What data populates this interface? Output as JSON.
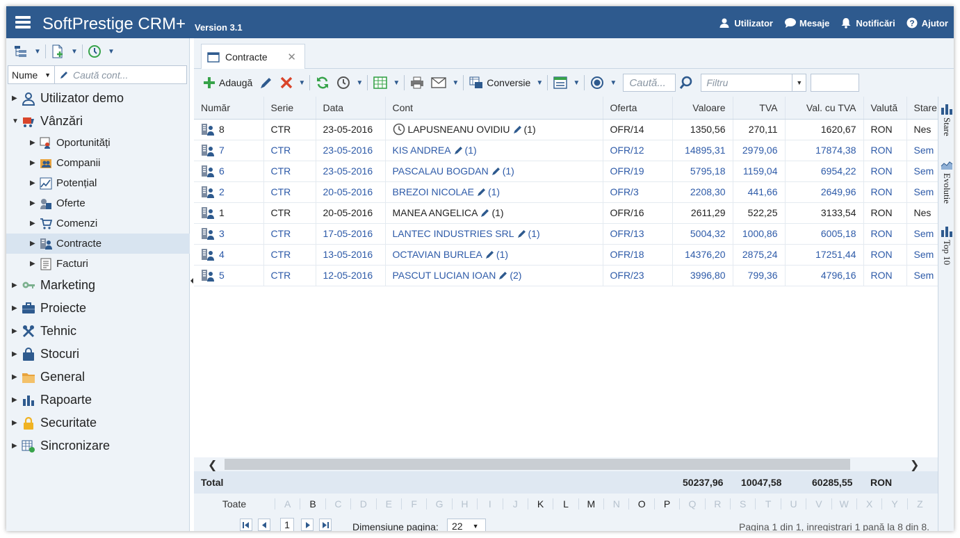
{
  "header": {
    "app_title": "SoftPrestige CRM+",
    "version": "Version 3.1",
    "links": [
      {
        "label": "Utilizator",
        "icon": "user-icon"
      },
      {
        "label": "Mesaje",
        "icon": "chat-icon"
      },
      {
        "label": "Notificări",
        "icon": "bell-icon"
      },
      {
        "label": "Ajutor",
        "icon": "help-icon"
      }
    ],
    "color": "#2e5a8e"
  },
  "sidebar": {
    "search": {
      "field": "Nume",
      "placeholder": "Caută cont..."
    },
    "tree": [
      {
        "label": "Utilizator demo",
        "icon": "user-outline-icon",
        "level": 1
      },
      {
        "label": "Vânzări",
        "icon": "cart-icon",
        "level": 1,
        "expanded": true
      },
      {
        "label": "Oportunități",
        "icon": "opportunity-icon",
        "level": 2
      },
      {
        "label": "Companii",
        "icon": "companies-icon",
        "level": 2
      },
      {
        "label": "Potențial",
        "icon": "chart-line-icon",
        "level": 2
      },
      {
        "label": "Oferte",
        "icon": "offers-icon",
        "level": 2
      },
      {
        "label": "Comenzi",
        "icon": "basket-icon",
        "level": 2
      },
      {
        "label": "Contracte",
        "icon": "contract-icon",
        "level": 2,
        "selected": true
      },
      {
        "label": "Facturi",
        "icon": "invoice-icon",
        "level": 2
      },
      {
        "label": "Marketing",
        "icon": "key-icon",
        "level": 1
      },
      {
        "label": "Proiecte",
        "icon": "briefcase-icon",
        "level": 1
      },
      {
        "label": "Tehnic",
        "icon": "tools-icon",
        "level": 1
      },
      {
        "label": "Stocuri",
        "icon": "bag-icon",
        "level": 1
      },
      {
        "label": "General",
        "icon": "folder-icon",
        "level": 1
      },
      {
        "label": "Rapoarte",
        "icon": "bar-chart-icon",
        "level": 1
      },
      {
        "label": "Securitate",
        "icon": "lock-icon",
        "level": 1
      },
      {
        "label": "Sincronizare",
        "icon": "sync-grid-icon",
        "level": 1
      }
    ]
  },
  "tab": {
    "label": "Contracte",
    "close": "✕"
  },
  "toolbar": {
    "add_label": "Adaugă",
    "convert_label": "Conversie",
    "search_placeholder": "Caută...",
    "filter_placeholder": "Filtru"
  },
  "grid": {
    "columns": [
      "Număr",
      "Serie",
      "Data",
      "Cont",
      "Oferta",
      "Valoare",
      "TVA",
      "Val. cu TVA",
      "Valută",
      "Stare"
    ],
    "rows": [
      {
        "num": "8",
        "serie": "CTR",
        "data": "23-05-2016",
        "cont": "LAPUSNEANU OVIDIU",
        "count": "(1)",
        "oferta": "OFR/14",
        "valoare": "1350,56",
        "tva": "270,11",
        "total": "1620,67",
        "valuta": "RON",
        "stare": "Nes",
        "style": "black",
        "clock": true
      },
      {
        "num": "7",
        "serie": "CTR",
        "data": "23-05-2016",
        "cont": "KIS ANDREA",
        "count": "(1)",
        "oferta": "OFR/12",
        "valoare": "14895,31",
        "tva": "2979,06",
        "total": "17874,38",
        "valuta": "RON",
        "stare": "Sem",
        "style": "blue"
      },
      {
        "num": "6",
        "serie": "CTR",
        "data": "23-05-2016",
        "cont": "PASCALAU BOGDAN",
        "count": "(1)",
        "oferta": "OFR/19",
        "valoare": "5795,18",
        "tva": "1159,04",
        "total": "6954,22",
        "valuta": "RON",
        "stare": "Sem",
        "style": "blue"
      },
      {
        "num": "2",
        "serie": "CTR",
        "data": "20-05-2016",
        "cont": "BREZOI NICOLAE",
        "count": "(1)",
        "oferta": "OFR/3",
        "valoare": "2208,30",
        "tva": "441,66",
        "total": "2649,96",
        "valuta": "RON",
        "stare": "Sem",
        "style": "blue"
      },
      {
        "num": "1",
        "serie": "CTR",
        "data": "20-05-2016",
        "cont": "MANEA ANGELICA",
        "count": "(1)",
        "oferta": "OFR/16",
        "valoare": "2611,29",
        "tva": "522,25",
        "total": "3133,54",
        "valuta": "RON",
        "stare": "Nes",
        "style": "black"
      },
      {
        "num": "3",
        "serie": "CTR",
        "data": "17-05-2016",
        "cont": "LANTEC INDUSTRIES SRL",
        "count": "(1)",
        "oferta": "OFR/13",
        "valoare": "5004,32",
        "tva": "1000,86",
        "total": "6005,18",
        "valuta": "RON",
        "stare": "Sem",
        "style": "blue"
      },
      {
        "num": "4",
        "serie": "CTR",
        "data": "13-05-2016",
        "cont": "OCTAVIAN BURLEA",
        "count": "(1)",
        "oferta": "OFR/18",
        "valoare": "14376,20",
        "tva": "2875,24",
        "total": "17251,44",
        "valuta": "RON",
        "stare": "Sem",
        "style": "blue"
      },
      {
        "num": "5",
        "serie": "CTR",
        "data": "12-05-2016",
        "cont": "PASCUT LUCIAN IOAN",
        "count": "(2)",
        "oferta": "OFR/23",
        "valoare": "3996,80",
        "tva": "799,36",
        "total": "4796,16",
        "valuta": "RON",
        "stare": "Sem",
        "style": "blue"
      }
    ],
    "totals": {
      "label": "Total",
      "valoare": "50237,96",
      "tva": "10047,58",
      "total": "60285,55",
      "valuta": "RON"
    }
  },
  "alphabet": {
    "all": "Toate",
    "letters": [
      {
        "l": "A",
        "on": false
      },
      {
        "l": "B",
        "on": true
      },
      {
        "l": "C",
        "on": false
      },
      {
        "l": "D",
        "on": false
      },
      {
        "l": "E",
        "on": false
      },
      {
        "l": "F",
        "on": false
      },
      {
        "l": "G",
        "on": false
      },
      {
        "l": "H",
        "on": false
      },
      {
        "l": "I",
        "on": false
      },
      {
        "l": "J",
        "on": false
      },
      {
        "l": "K",
        "on": true
      },
      {
        "l": "L",
        "on": true
      },
      {
        "l": "M",
        "on": true
      },
      {
        "l": "N",
        "on": false
      },
      {
        "l": "O",
        "on": true
      },
      {
        "l": "P",
        "on": true
      },
      {
        "l": "Q",
        "on": false
      },
      {
        "l": "R",
        "on": false
      },
      {
        "l": "S",
        "on": false
      },
      {
        "l": "T",
        "on": false
      },
      {
        "l": "U",
        "on": false
      },
      {
        "l": "V",
        "on": false
      },
      {
        "l": "W",
        "on": false
      },
      {
        "l": "X",
        "on": false
      },
      {
        "l": "Y",
        "on": false
      },
      {
        "l": "Z",
        "on": false
      }
    ]
  },
  "pager": {
    "current_page": "1",
    "size_label": "Dimensiune pagina:",
    "size_value": "22",
    "info": "Pagina 1 din 1, inregistrari 1 pană la 8 din 8."
  },
  "rail": [
    {
      "label": "Stare",
      "icon": "bar-chart-icon"
    },
    {
      "label": "Evolutie",
      "icon": "area-chart-icon"
    },
    {
      "label": "Top 10",
      "icon": "bar-chart-icon"
    }
  ]
}
